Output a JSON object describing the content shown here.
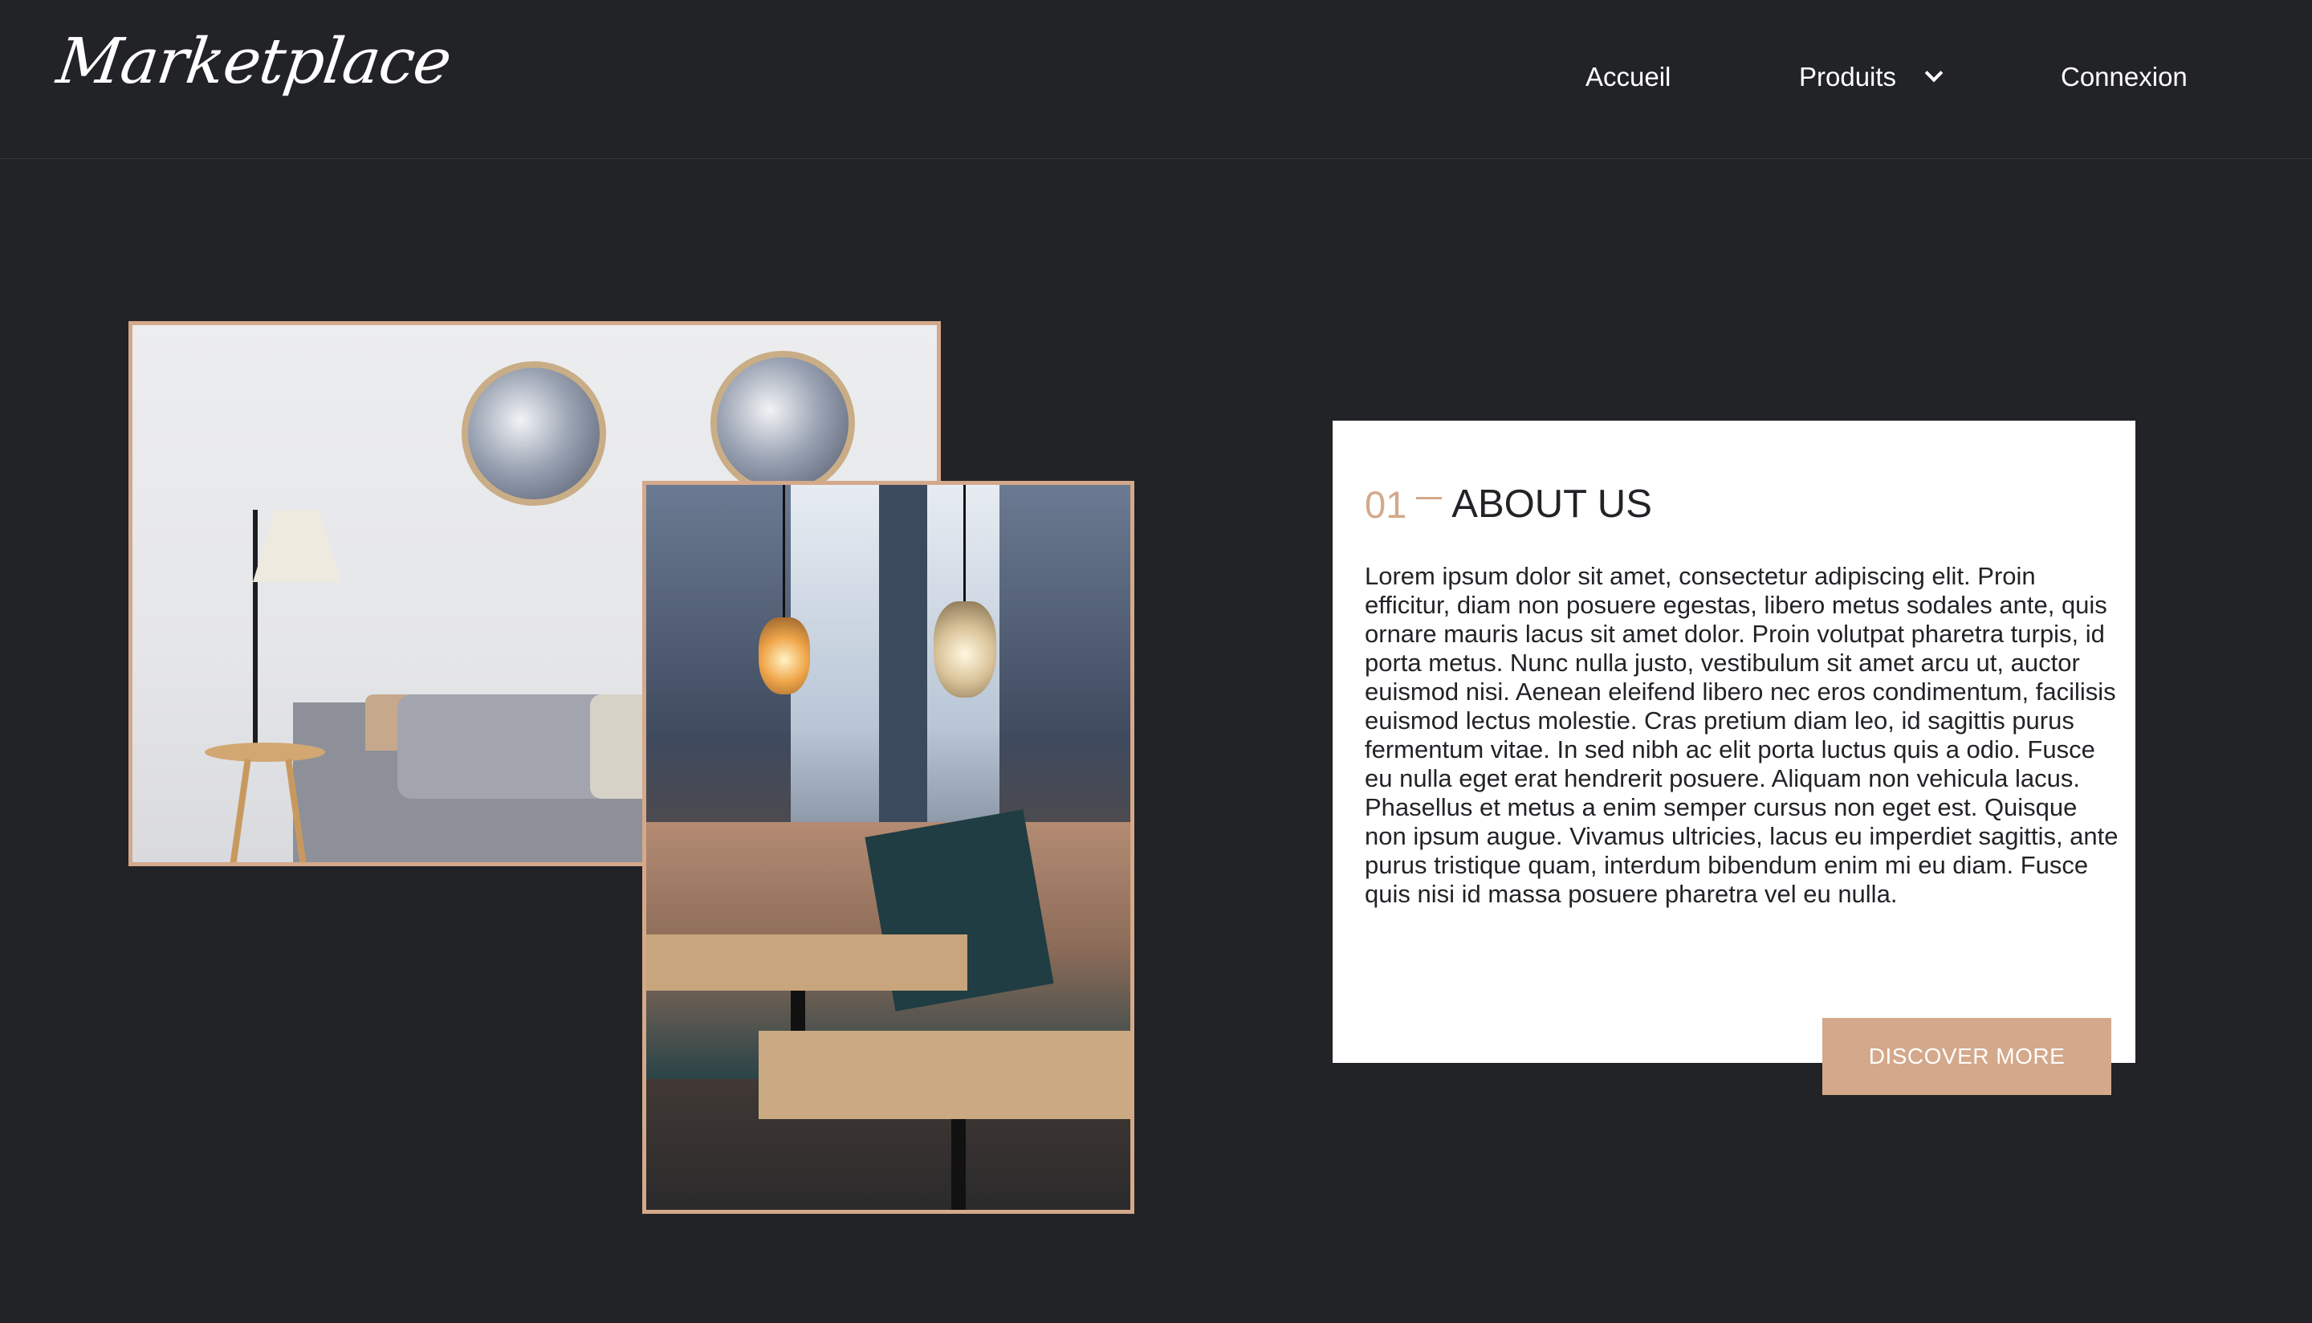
{
  "brand": {
    "logo_text": "Marketplace"
  },
  "nav": {
    "home_label": "Accueil",
    "products_label": "Produits",
    "login_label": "Connexion"
  },
  "about": {
    "number": "01",
    "title": "ABOUT US",
    "body": "Lorem ipsum dolor sit amet, consectetur adipiscing elit. Proin efficitur, diam non posuere egestas, libero metus sodales ante, quis ornare mauris lacus sit amet dolor. Proin volutpat pharetra turpis, id porta metus. Nunc nulla justo, vestibulum sit amet arcu ut, auctor euismod nisi. Aenean eleifend libero nec eros condimentum, facilisis euismod lectus molestie. Cras pretium diam leo, id sagittis purus fermentum vitae. In sed nibh ac elit porta luctus quis a odio. Fusce eu nulla eget erat hendrerit posuere. Aliquam non vehicula lacus. Phasellus et metus a enim semper cursus non eget est. Quisque non ipsum augue. Vivamus ultricies, lacus eu imperdiet sagittis, ante purus tristique quam, interdum bibendum enim mi eu diam. Fusce quis nisi id massa posuere pharetra vel eu nulla.",
    "cta_label": "DISCOVER MORE"
  },
  "colors": {
    "background": "#222327",
    "accent": "#d4a88a",
    "card": "#ffffff",
    "text_dark": "#222327"
  },
  "icons": {
    "products_dropdown": "chevron-down-icon"
  }
}
